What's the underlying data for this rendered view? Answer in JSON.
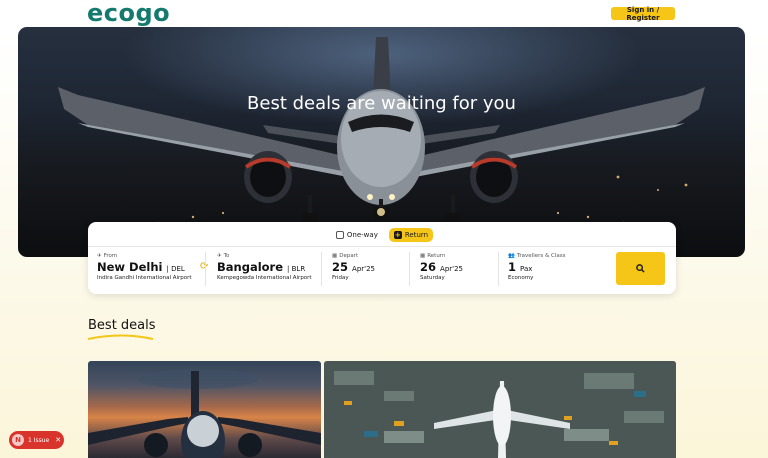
{
  "header": {
    "logo_text": "ecogo",
    "signin_label": "Sign in / Register"
  },
  "hero": {
    "title": "Best deals are waiting for you"
  },
  "search": {
    "trip_types": [
      {
        "label": "One-way",
        "selected": false
      },
      {
        "label": "Return",
        "selected": true
      }
    ],
    "from": {
      "label": "From",
      "city": "New Delhi",
      "code": "| DEL",
      "airport": "Indira Gandhi International Airport"
    },
    "to": {
      "label": "To",
      "city": "Bangalore",
      "code": "| BLR",
      "airport": "Kempegowda International Airport"
    },
    "depart": {
      "label": "Depart",
      "day": "25",
      "month_year": "Apr'25",
      "weekday": "Friday"
    },
    "return": {
      "label": "Return",
      "day": "26",
      "month_year": "Apr'25",
      "weekday": "Saturday"
    },
    "travellers": {
      "label": "Travellers & Class",
      "count": "1",
      "unit": "Pax",
      "class": "Economy"
    },
    "search_icon": "search-icon"
  },
  "deals": {
    "title": "Best deals"
  },
  "issues": {
    "avatar_letter": "N",
    "label": "1 Issue"
  },
  "colors": {
    "accent": "#f5c518",
    "brand": "#157a6e",
    "issue": "#d9342b"
  }
}
